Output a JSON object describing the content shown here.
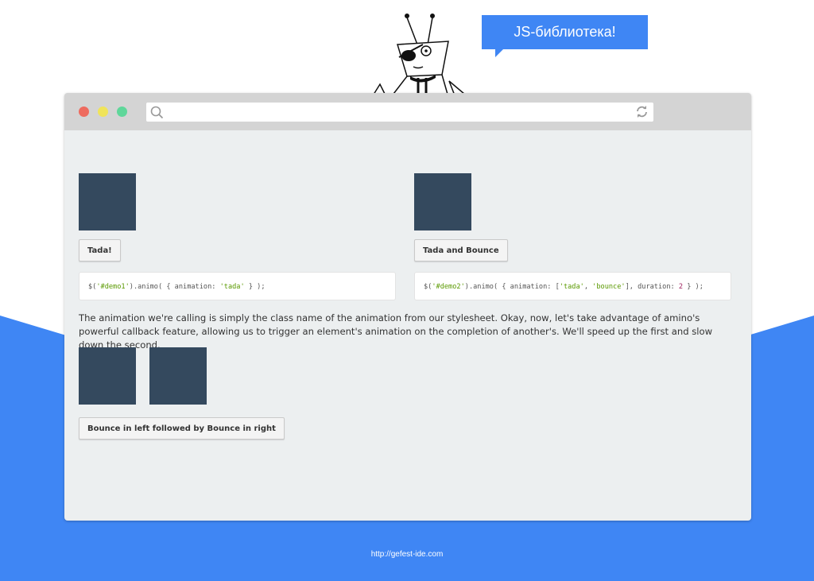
{
  "banner": {
    "bubble_text": "JS-библиотека!",
    "accent_color": "#3f86f4"
  },
  "browser": {
    "window_controls": [
      {
        "name": "close",
        "color": "#ee6b5f"
      },
      {
        "name": "minimize",
        "color": "#f0e45a"
      },
      {
        "name": "maximize",
        "color": "#5fd79a"
      }
    ],
    "address_bar": {
      "value": "",
      "search_icon": "search-icon",
      "reload_icon": "reload-icon"
    }
  },
  "demo": {
    "demo1": {
      "button": "Tada!",
      "code": [
        "$(",
        "'#demo1'",
        ").animo( { animation: ",
        "'tada'",
        " } );"
      ]
    },
    "demo2": {
      "button": "Tada and Bounce",
      "code": [
        "$(",
        "'#demo2'",
        ").animo( { animation: [",
        "'tada'",
        ", ",
        "'bounce'",
        "], duration: ",
        "2",
        " } );"
      ]
    },
    "paragraph": "The animation we're calling is simply the class name of the animation from our stylesheet. Okay, now, let's take advantage of amino's powerful callback feature, allowing us to trigger an element's animation on the completion of another's. We'll speed up the first and slow down the second.",
    "demo3": {
      "button": "Bounce in left followed by Bounce in right"
    },
    "box_color": "#34495e"
  },
  "footer": {
    "url": "http://gefest-ide.com"
  }
}
